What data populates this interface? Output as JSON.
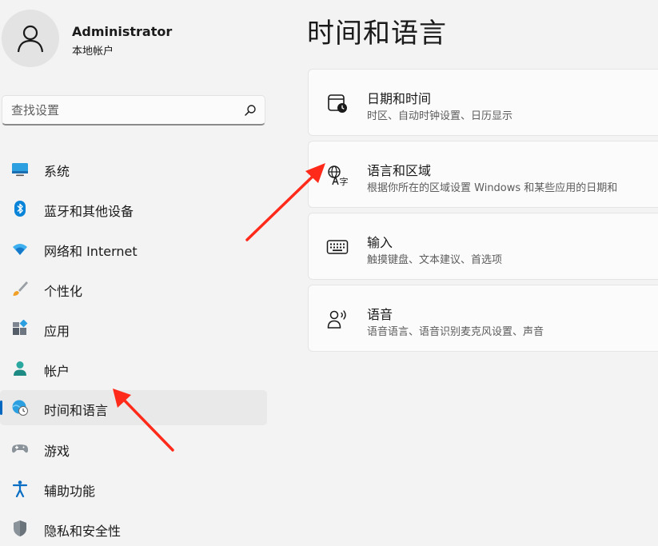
{
  "user": {
    "name": "Administrator",
    "account_type": "本地帐户"
  },
  "search": {
    "placeholder": "查找设置"
  },
  "nav": {
    "items": [
      {
        "label": "系统",
        "icon": "monitor-icon"
      },
      {
        "label": "蓝牙和其他设备",
        "icon": "bluetooth-icon"
      },
      {
        "label": "网络和 Internet",
        "icon": "wifi-icon"
      },
      {
        "label": "个性化",
        "icon": "paintbrush-icon"
      },
      {
        "label": "应用",
        "icon": "apps-icon"
      },
      {
        "label": "帐户",
        "icon": "account-icon"
      },
      {
        "label": "时间和语言",
        "icon": "globe-clock-icon",
        "selected": true
      },
      {
        "label": "游戏",
        "icon": "gamepad-icon"
      },
      {
        "label": "辅助功能",
        "icon": "accessibility-icon"
      },
      {
        "label": "隐私和安全性",
        "icon": "shield-icon"
      }
    ]
  },
  "page": {
    "title": "时间和语言",
    "cards": [
      {
        "title": "日期和时间",
        "subtitle": "时区、自动时钟设置、日历显示",
        "icon": "calendar-clock-icon"
      },
      {
        "title": "语言和区域",
        "subtitle": "根据你所在的区域设置 Windows 和某些应用的日期和",
        "icon": "language-icon"
      },
      {
        "title": "输入",
        "subtitle": "触摸键盘、文本建议、首选项",
        "icon": "keyboard-icon"
      },
      {
        "title": "语音",
        "subtitle": "语音语言、语音识别麦克风设置、声音",
        "icon": "speech-icon"
      }
    ]
  },
  "colors": {
    "accent": "#0067c0",
    "annotation_arrow": "#ff2a1a",
    "background": "#f3f3f3",
    "card": "#fbfbfb"
  }
}
